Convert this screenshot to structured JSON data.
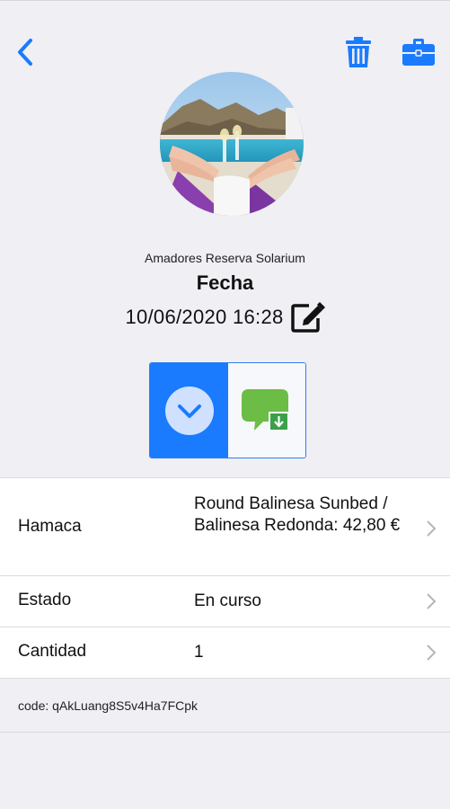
{
  "header": {
    "back_icon": "chevron-left-icon",
    "trash_icon": "trash-icon",
    "briefcase_icon": "briefcase-icon",
    "accent_color": "#1a7bff"
  },
  "reservation": {
    "venue": "Amadores Reserva Solarium",
    "date_label": "Fecha",
    "date_value": "10/06/2020 16:28",
    "edit_icon": "edit-icon"
  },
  "actions": {
    "left_icon": "chevron-down-circle-icon",
    "right_icon": "chat-download-icon"
  },
  "details": [
    {
      "label": "Hamaca",
      "value": "Round Balinesa Sunbed / Balinesa Redonda: 42,80 €"
    },
    {
      "label": "Estado",
      "value": "En curso"
    },
    {
      "label": "Cantidad",
      "value": "1"
    }
  ],
  "code_text": "code: qAkLuang8S5v4Ha7FCpk"
}
